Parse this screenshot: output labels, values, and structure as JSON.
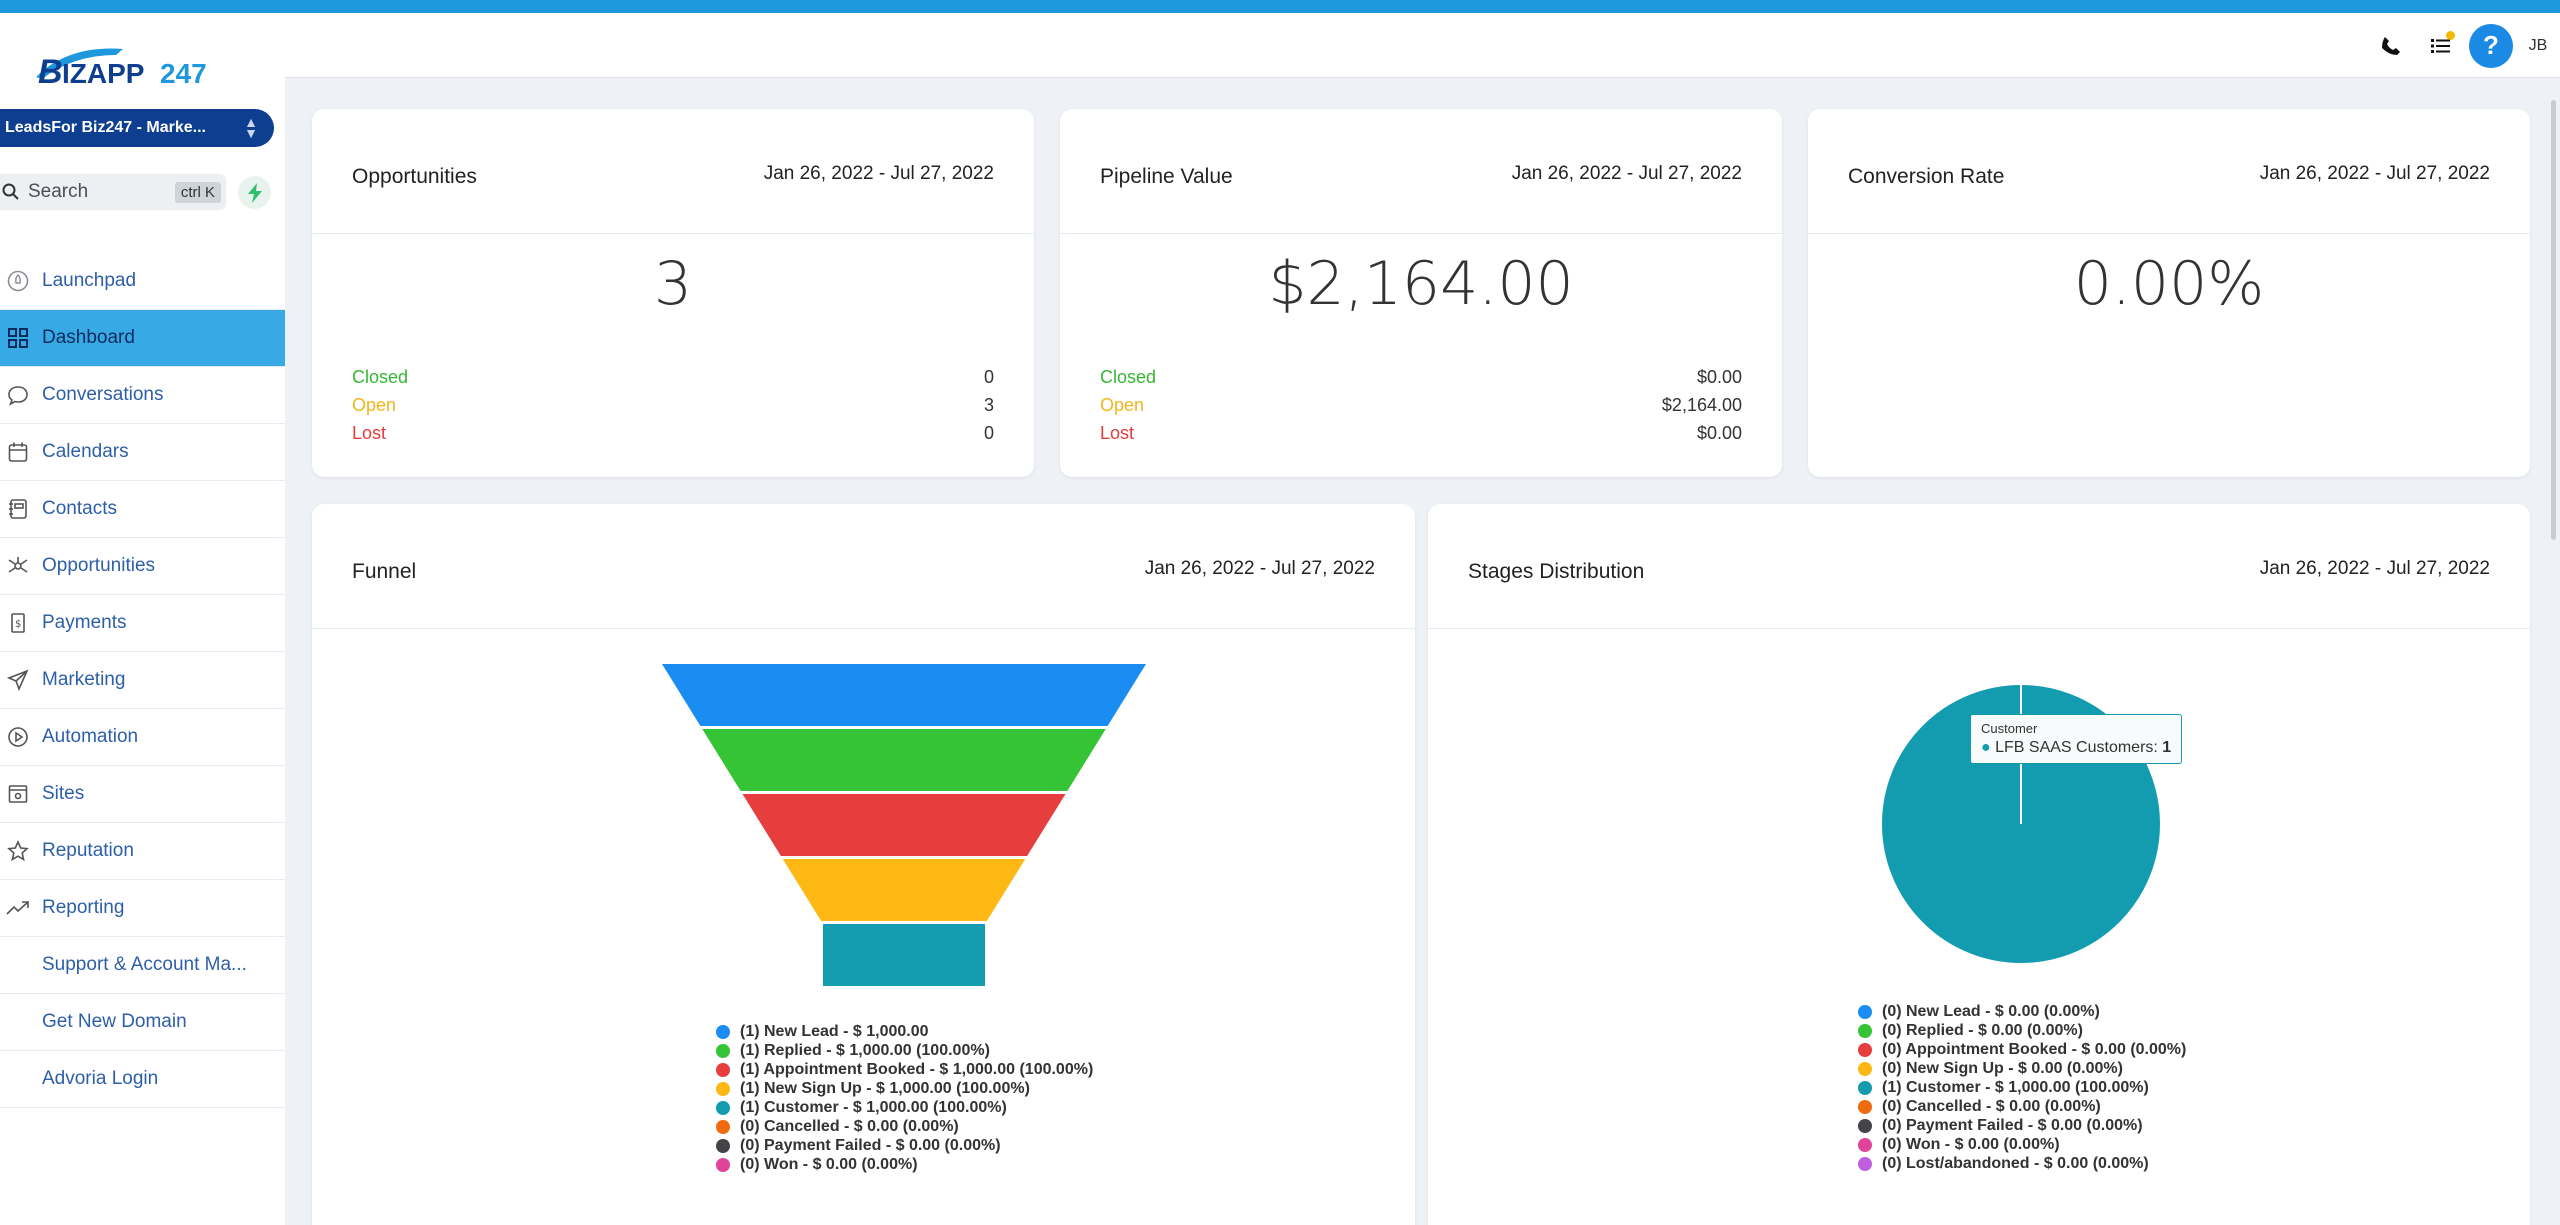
{
  "brand": {
    "logo_text": "BIZAPP247",
    "accent": "#1f97dc"
  },
  "sidebar": {
    "location_select": "LeadsFor Biz247 - Marke...",
    "search": {
      "label": "Search",
      "shortcut": "ctrl K"
    },
    "items": [
      {
        "label": "Launchpad",
        "icon": "rocket-icon"
      },
      {
        "label": "Dashboard",
        "icon": "grid-icon",
        "active": true
      },
      {
        "label": "Conversations",
        "icon": "chat-bubble-icon"
      },
      {
        "label": "Calendars",
        "icon": "calendar-icon"
      },
      {
        "label": "Contacts",
        "icon": "contact-card-icon"
      },
      {
        "label": "Opportunities",
        "icon": "network-icon"
      },
      {
        "label": "Payments",
        "icon": "receipt-icon"
      },
      {
        "label": "Marketing",
        "icon": "send-icon"
      },
      {
        "label": "Automation",
        "icon": "play-circle-icon"
      },
      {
        "label": "Sites",
        "icon": "browser-icon"
      },
      {
        "label": "Reputation",
        "icon": "star-icon"
      },
      {
        "label": "Reporting",
        "icon": "trending-up-icon"
      },
      {
        "label": "Support & Account Ma..."
      },
      {
        "label": "Get New Domain"
      },
      {
        "label": "Advoria Login"
      }
    ]
  },
  "header": {
    "initials": "JB",
    "help": "?"
  },
  "cards": {
    "opportunities": {
      "title": "Opportunities",
      "date": "Jan 26, 2022 - Jul 27, 2022",
      "value": "3",
      "rows": [
        {
          "label": "Closed",
          "value": "0"
        },
        {
          "label": "Open",
          "value": "3"
        },
        {
          "label": "Lost",
          "value": "0"
        }
      ]
    },
    "pipeline": {
      "title": "Pipeline Value",
      "date": "Jan 26, 2022 - Jul 27, 2022",
      "value": "$2,164.00",
      "rows": [
        {
          "label": "Closed",
          "value": "$0.00"
        },
        {
          "label": "Open",
          "value": "$2,164.00"
        },
        {
          "label": "Lost",
          "value": "$0.00"
        }
      ]
    },
    "conversion": {
      "title": "Conversion Rate",
      "date": "Jan 26, 2022 - Jul 27, 2022",
      "value": "0.00%"
    },
    "funnel": {
      "title": "Funnel",
      "date": "Jan 26, 2022 - Jul 27, 2022"
    },
    "stages": {
      "title": "Stages Distribution",
      "date": "Jan 26, 2022 - Jul 27, 2022",
      "tooltip": {
        "title": "Customer",
        "series": "LFB SAAS Customers:",
        "value": "1"
      }
    }
  },
  "chart_data": [
    {
      "type": "funnel",
      "title": "Funnel",
      "legend": [
        {
          "text": "(1) New Lead - $ 1,000.00",
          "color": "#1a8cf2"
        },
        {
          "text": "(1) Replied - $ 1,000.00 (100.00%)",
          "color": "#35c435"
        },
        {
          "text": "(1) Appointment Booked - $ 1,000.00 (100.00%)",
          "color": "#e63d3d"
        },
        {
          "text": "(1) New Sign Up - $ 1,000.00 (100.00%)",
          "color": "#fdb813"
        },
        {
          "text": "(1) Customer - $ 1,000.00 (100.00%)",
          "color": "#139cb0"
        },
        {
          "text": "(0) Cancelled - $ 0.00 (0.00%)",
          "color": "#f06a0f"
        },
        {
          "text": "(0) Payment Failed - $ 0.00 (0.00%)",
          "color": "#434348"
        },
        {
          "text": "(0) Won - $ 0.00 (0.00%)",
          "color": "#e0449a"
        }
      ],
      "segments": [
        {
          "name": "New Lead",
          "count": 1,
          "color": "#1a8cf2"
        },
        {
          "name": "Replied",
          "count": 1,
          "color": "#35c435"
        },
        {
          "name": "Appointment Booked",
          "count": 1,
          "color": "#e63d3d"
        },
        {
          "name": "New Sign Up",
          "count": 1,
          "color": "#fdb813"
        },
        {
          "name": "Customer",
          "count": 1,
          "color": "#139cb0"
        }
      ]
    },
    {
      "type": "pie",
      "title": "Stages Distribution",
      "slices": [
        {
          "name": "Customer",
          "value": 1,
          "color": "#139cb0"
        }
      ],
      "legend": [
        {
          "text": "(0) New Lead - $ 0.00 (0.00%)",
          "color": "#1a8cf2"
        },
        {
          "text": "(0) Replied - $ 0.00 (0.00%)",
          "color": "#35c435"
        },
        {
          "text": "(0) Appointment Booked - $ 0.00 (0.00%)",
          "color": "#e63d3d"
        },
        {
          "text": "(0) New Sign Up - $ 0.00 (0.00%)",
          "color": "#fdb813"
        },
        {
          "text": "(1) Customer - $ 1,000.00 (100.00%)",
          "color": "#139cb0"
        },
        {
          "text": "(0) Cancelled - $ 0.00 (0.00%)",
          "color": "#f06a0f"
        },
        {
          "text": "(0) Payment Failed - $ 0.00 (0.00%)",
          "color": "#434348"
        },
        {
          "text": "(0) Won - $ 0.00 (0.00%)",
          "color": "#e0449a"
        },
        {
          "text": "(0) Lost/abandoned - $ 0.00 (0.00%)",
          "color": "#c05ee0"
        }
      ]
    }
  ]
}
